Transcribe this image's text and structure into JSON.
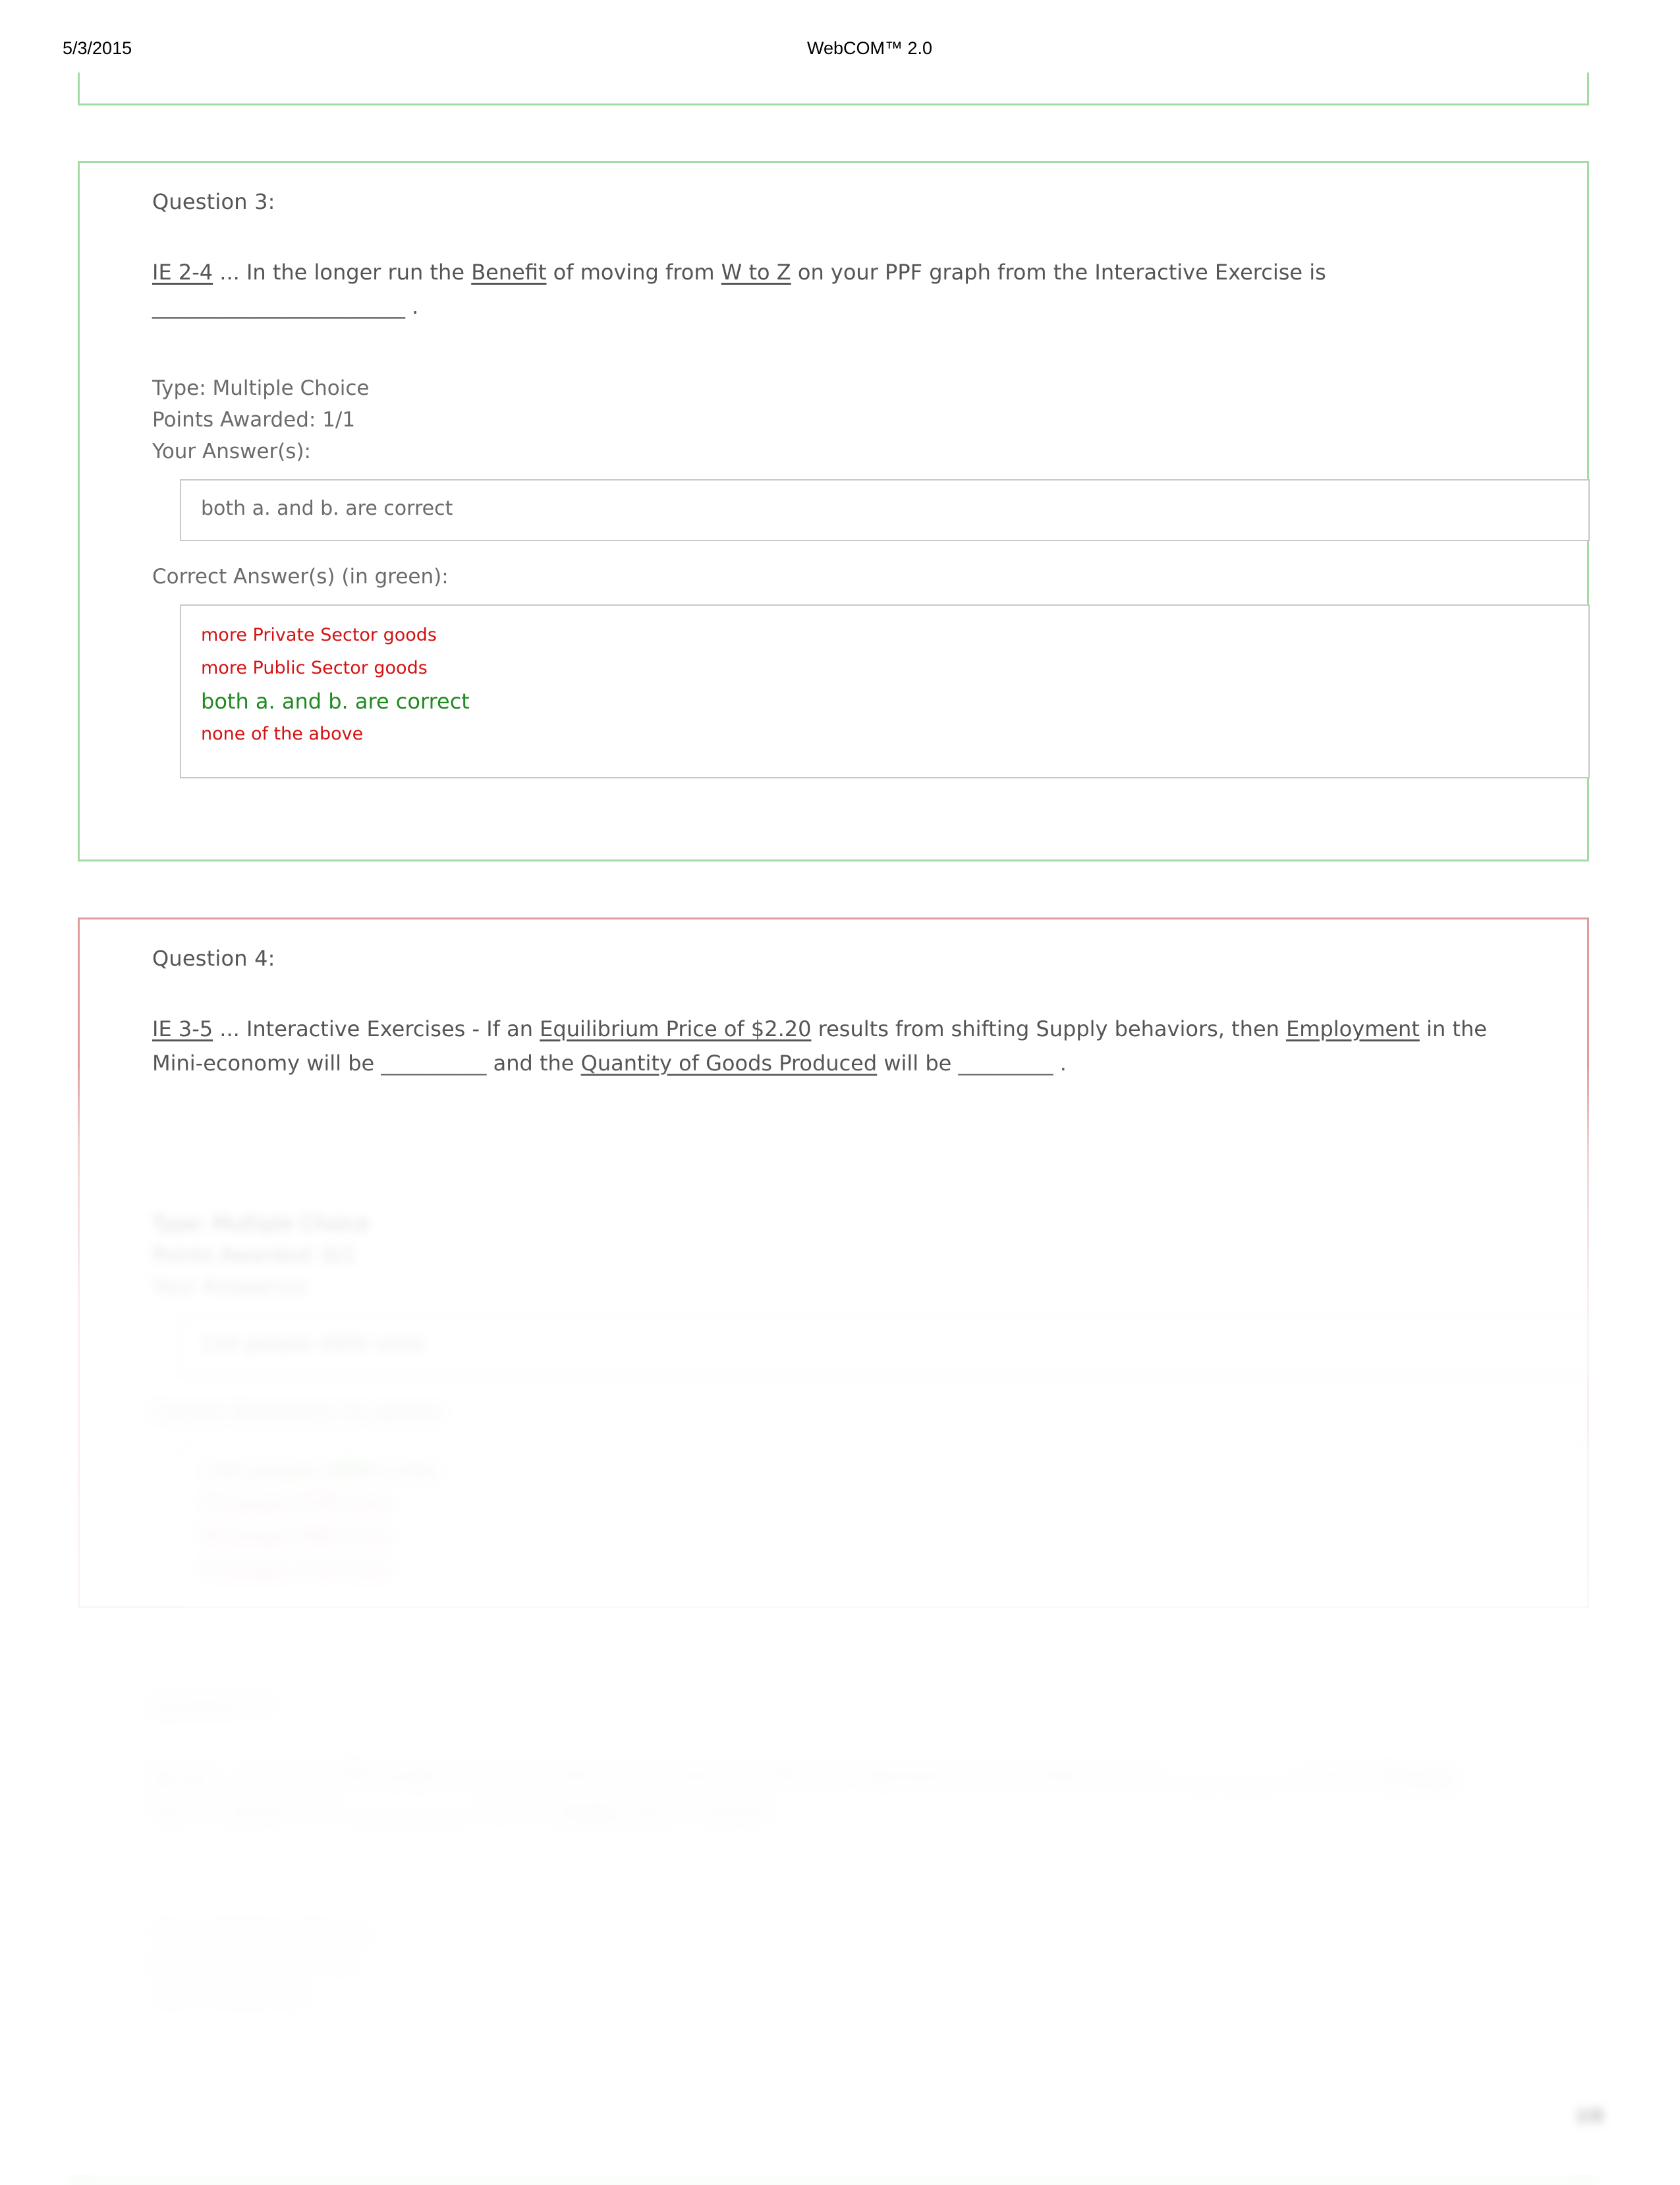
{
  "header": {
    "date": "5/3/2015",
    "title": "WebCOM™ 2.0"
  },
  "questions": [
    {
      "label": "Question 3:",
      "code": "IE 2-4",
      "text_html": "<u>IE 2-4</u> ... In the longer run the <u>Benefit</u> of moving from <u>W to Z</u> on your PPF graph from the Interactive Exercise is ________________________ .",
      "type_line": "Type: Multiple Choice",
      "points_line": "Points Awarded: 1/1",
      "your_answer_label": "Your Answer(s):",
      "your_answers": [
        "both a. and b. are correct"
      ],
      "correct_label": "Correct Answer(s) (in green):",
      "options": [
        {
          "text": "more Private Sector goods",
          "state": "wrong"
        },
        {
          "text": "more Public Sector goods",
          "state": "wrong"
        },
        {
          "text": "both a. and b. are correct",
          "state": "correct"
        },
        {
          "text": "none of the above",
          "state": "wrong"
        }
      ],
      "border_color": "#a3dca3"
    },
    {
      "label": "Question 4:",
      "code": "IE 3-5",
      "text_html": "<u>IE 3-5</u> ... Interactive Exercises - If an <u>Equilibrium Price of $2.20</u> results from shifting Supply behaviors, then <u>Employment</u> in the Mini-economy will be __________ and the <u>Quantity of Goods Produced</u> will be _________ .",
      "type_line": "Type: Multiple Choice",
      "points_line": "Points Awarded: 0/1",
      "your_answer_label": "Your Answer(s):",
      "your_answers": [
        "110 people    4900 units"
      ],
      "correct_label": "Correct Answer(s) (in green):",
      "options": [
        {
          "text": "130 people    6900 units",
          "state": "correct"
        },
        {
          "text": "70 people    4700 units",
          "state": "wrong"
        },
        {
          "text": "90 people    5900 units",
          "state": "wrong"
        },
        {
          "text": "50 people    1700 units",
          "state": "wrong"
        }
      ],
      "border_color": "#e09b9b"
    },
    {
      "label": "Question 5:",
      "code": "IE 2-4",
      "text_html": "<u>IE 2-4</u> ... On your PPF graph from the Interactive Exercise, Point 'P' represents the production of ____________ units of <u>Private</u> Sector goods and ____________ units of <u>Public</u> Sector goods.",
      "type_line": "Type: Multiple Choice",
      "points_line": "Points Awarded: 1/1",
      "your_answer_label": "Your Answer(s):",
      "your_answers": [],
      "correct_label": "",
      "options": [],
      "border_color": "#a3dca3"
    }
  ],
  "page_marker": "2/8"
}
